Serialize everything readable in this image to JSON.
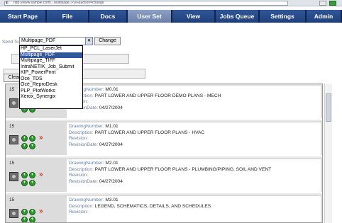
{
  "browser": {
    "address": "http://www.sample.com/...Multipage_PDF&action=change"
  },
  "nav": {
    "tabs": [
      {
        "label": "Start Page"
      },
      {
        "label": "File"
      },
      {
        "label": "Docs"
      },
      {
        "label": "User Set",
        "active": true
      },
      {
        "label": "View"
      },
      {
        "label": "Jobs Queue"
      },
      {
        "label": "Settings"
      },
      {
        "label": "Admin"
      }
    ]
  },
  "send": {
    "label": "Send To",
    "selected": "Multipage_PDF",
    "change_label": "Change",
    "clear_label": "Clear",
    "options": [
      "HP_PCL_LaserJet",
      "Multipage_PDF",
      "Multipage_TIFF",
      "IntraNETIK_Job_Submit",
      "KIP_PowerPrint",
      "Ocè_TDS",
      "Ocè_ReproDesk",
      "PLP_PlotWorks",
      "Xerox_Synergix"
    ]
  },
  "list": {
    "labels": {
      "drawing": "DrawingNumber:",
      "description": "Description:",
      "revision": "Revision:",
      "revdate": "RevisionDate:"
    },
    "rows": [
      {
        "num": "15",
        "drawing": "M0.01",
        "description": "PART LOWER AND UPPER FLOOR DEMO PLANS - MECH",
        "revision": "",
        "revdate": "04/27/2004"
      },
      {
        "num": "15",
        "drawing": "M1.01",
        "description": "PART LOWER AND UPPER FLOOR PLANS - HVAC",
        "revision": "",
        "revdate": "04/27/2004"
      },
      {
        "num": "15",
        "drawing": "M2.01",
        "description": "PART LOWER AND UPPER FLOOR PLANS - PLUMBING/PIPING, SOIL AND VENT",
        "revision": "",
        "revdate": "04/27/2004"
      },
      {
        "num": "15",
        "drawing": "M3.01",
        "description": "LEGEND, SCHEMATICS, DETAILS, AND SCHEDULES",
        "revision": "",
        "revdate": ""
      }
    ]
  },
  "colors": {
    "nav_bg": "#1e3f7a",
    "nav_active": "#6b80a8",
    "label_blue": "#6a7fa0",
    "go_green": "#2d9a2d",
    "delete_red": "#c03a1f"
  }
}
